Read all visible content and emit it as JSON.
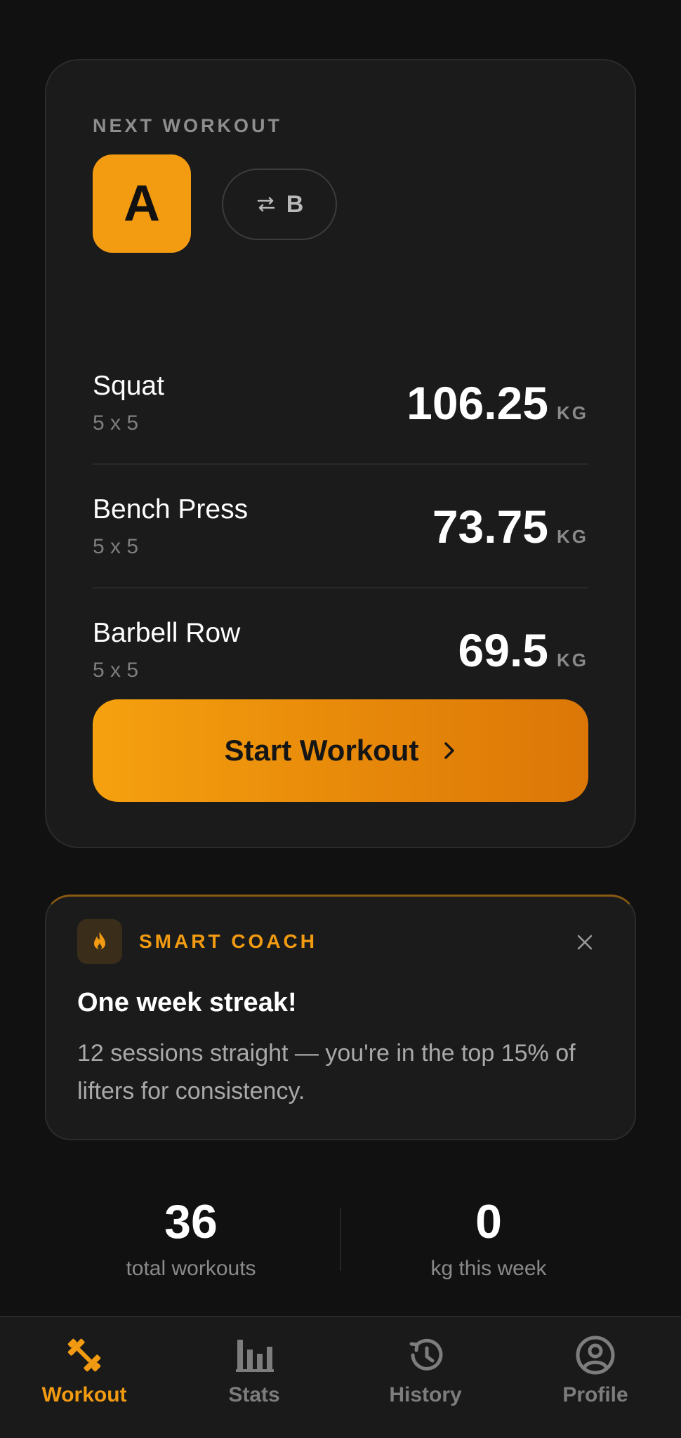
{
  "workout_card": {
    "section_label": "NEXT WORKOUT",
    "selected_variant": "A",
    "alternate_variant": "B",
    "exercises": [
      {
        "name": "Squat",
        "scheme": "5 x 5",
        "weight": "106.25",
        "unit": "KG"
      },
      {
        "name": "Bench Press",
        "scheme": "5 x 5",
        "weight": "73.75",
        "unit": "KG"
      },
      {
        "name": "Barbell Row",
        "scheme": "5 x 5",
        "weight": "69.5",
        "unit": "KG"
      }
    ],
    "start_button": "Start Workout"
  },
  "coach": {
    "label": "SMART COACH",
    "title": "One week streak!",
    "body": "12 sessions straight — you're in the top 15% of lifters for consistency."
  },
  "stats": [
    {
      "value": "36",
      "label": "total workouts"
    },
    {
      "value": "0",
      "label": "kg this week"
    }
  ],
  "nav": [
    {
      "label": "Workout",
      "icon": "dumbbell-icon",
      "active": true
    },
    {
      "label": "Stats",
      "icon": "bar-chart-icon",
      "active": false
    },
    {
      "label": "History",
      "icon": "history-icon",
      "active": false
    },
    {
      "label": "Profile",
      "icon": "profile-icon",
      "active": false
    }
  ],
  "colors": {
    "accent": "#f29b12",
    "background": "#111111",
    "card": "#1b1b1b"
  }
}
